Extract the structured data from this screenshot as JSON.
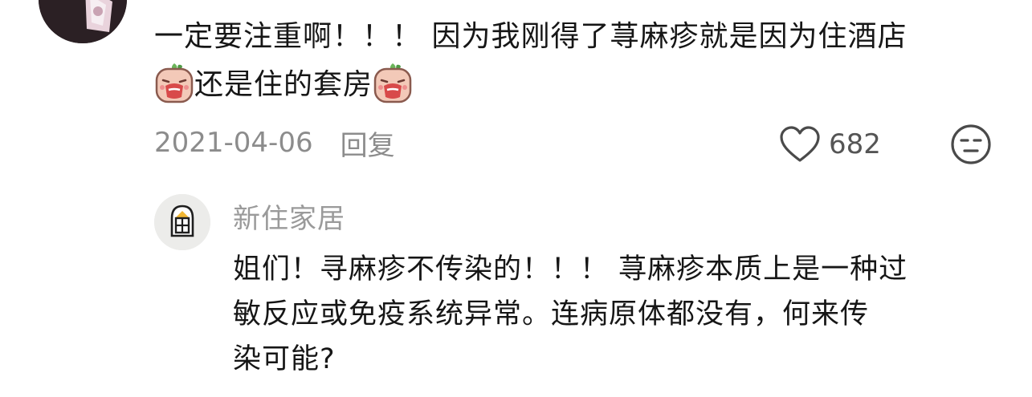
{
  "comment": {
    "text_line1": "一定要注重啊！！！ 因为我刚得了荨麻疹就是因为住酒店",
    "text_line2": "还是住的套房",
    "emoji_icon": "crying-peach-emoji",
    "date": "2021-04-06",
    "reply_label": "回复",
    "like_count": "682"
  },
  "reply": {
    "author": "新住家居",
    "text_line1": "姐们！寻麻疹不传染的！！！ 荨麻疹本质上是一种过",
    "text_line2": "敏反应或免疫系统异常。连病原体都没有，何来传",
    "text_line3": "染可能?"
  },
  "colors": {
    "meta_text": "#8c8c8c",
    "author_text": "#9a9a9a",
    "body_text": "#161616"
  }
}
